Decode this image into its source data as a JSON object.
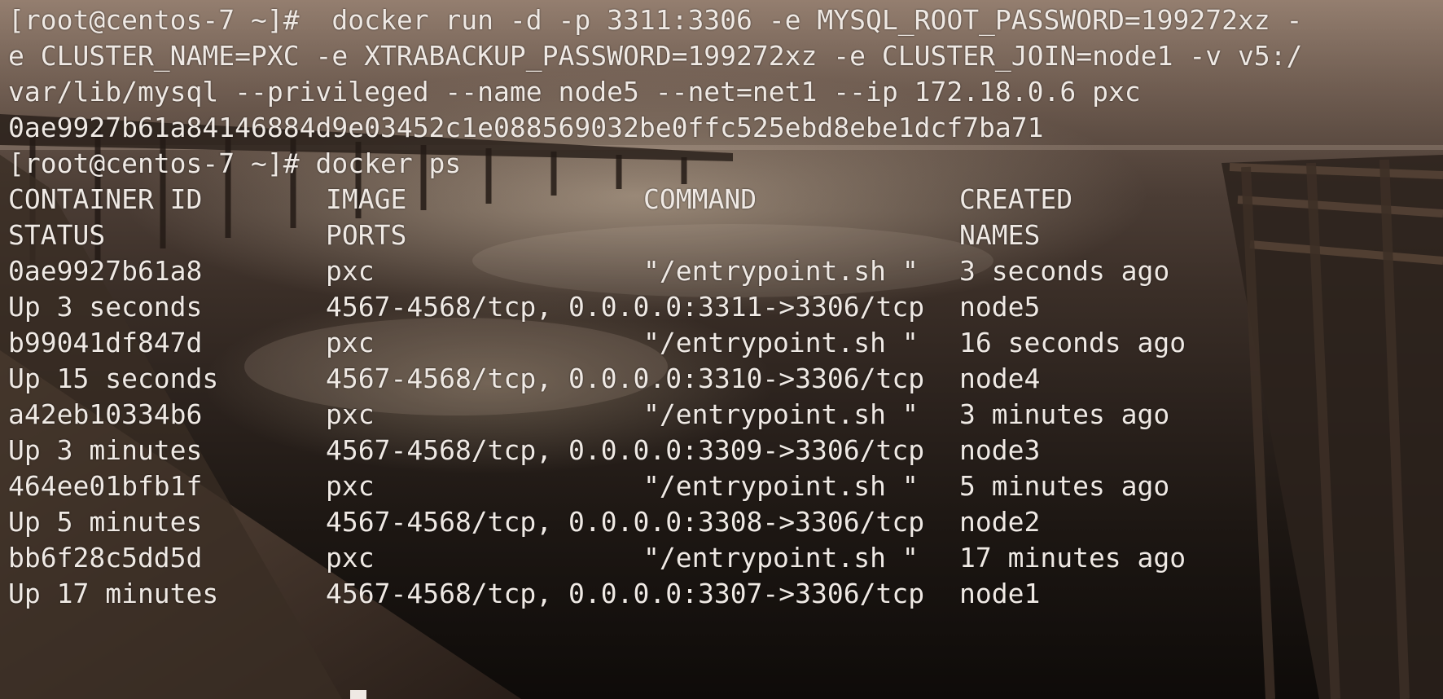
{
  "terminal": {
    "colors": {
      "text": "#efe9e4",
      "background_dark": "#0e0b09",
      "background_light": "#8a7566"
    },
    "command_lines": [
      "[root@centos-7 ~]#  docker run -d -p 3311:3306 -e MYSQL_ROOT_PASSWORD=199272xz -",
      "e CLUSTER_NAME=PXC -e XTRABACKUP_PASSWORD=199272xz -e CLUSTER_JOIN=node1 -v v5:/",
      "var/lib/mysql --privileged --name node5 --net=net1 --ip 172.18.0.6 pxc",
      "0ae9927b61a84146884d9e03452c1e088569032be0ffc525ebd8ebe1dcf7ba71",
      "[root@centos-7 ~]# docker ps"
    ],
    "ps_header_1": [
      "CONTAINER ID",
      "IMAGE",
      "COMMAND",
      "CREATED"
    ],
    "ps_header_2": [
      "STATUS",
      "PORTS",
      "",
      "NAMES"
    ],
    "containers": [
      {
        "id": "0ae9927b61a8",
        "image": "pxc",
        "command": "\"/entrypoint.sh \"",
        "created": "3 seconds ago",
        "status": "Up 3 seconds",
        "ports": "4567-4568/tcp, 0.0.0.0:3311->3306/tcp",
        "name": "node5"
      },
      {
        "id": "b99041df847d",
        "image": "pxc",
        "command": "\"/entrypoint.sh \"",
        "created": "16 seconds ago",
        "status": "Up 15 seconds",
        "ports": "4567-4568/tcp, 0.0.0.0:3310->3306/tcp",
        "name": "node4"
      },
      {
        "id": "a42eb10334b6",
        "image": "pxc",
        "command": "\"/entrypoint.sh \"",
        "created": "3 minutes ago",
        "status": "Up 3 minutes",
        "ports": "4567-4568/tcp, 0.0.0.0:3309->3306/tcp",
        "name": "node3"
      },
      {
        "id": "464ee01bfb1f",
        "image": "pxc",
        "command": "\"/entrypoint.sh \"",
        "created": "5 minutes ago",
        "status": "Up 5 minutes",
        "ports": "4567-4568/tcp, 0.0.0.0:3308->3306/tcp",
        "name": "node2"
      },
      {
        "id": "bb6f28c5dd5d",
        "image": "pxc",
        "command": "\"/entrypoint.sh \"",
        "created": "17 minutes ago",
        "status": "Up 17 minutes",
        "ports": "4567-4568/tcp, 0.0.0.0:3307->3306/tcp",
        "name": "node1"
      }
    ]
  }
}
